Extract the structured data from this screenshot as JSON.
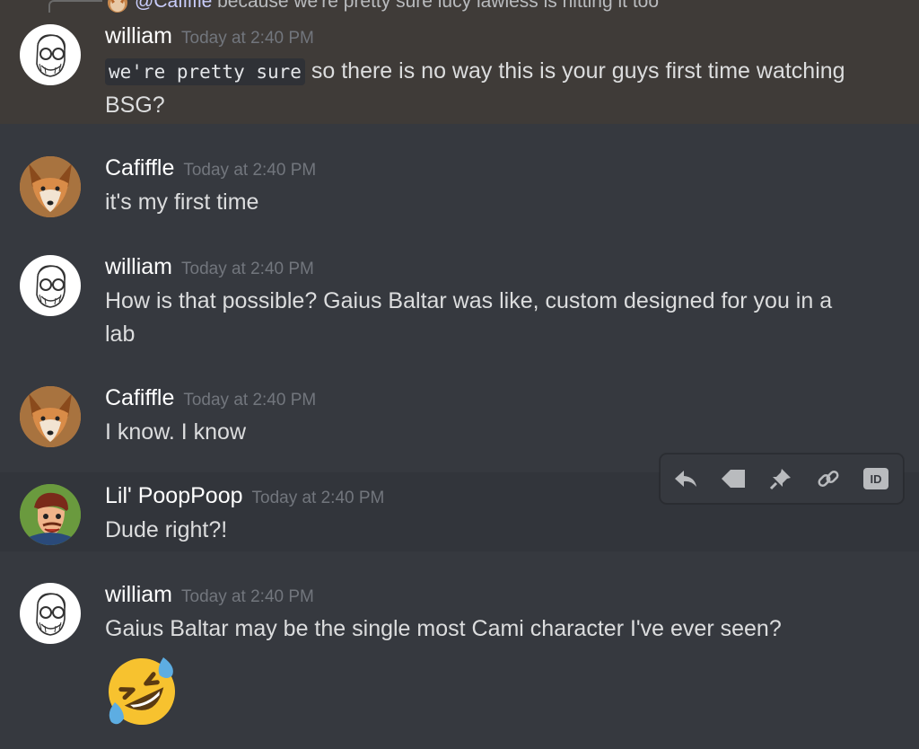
{
  "reply_preview": {
    "mention": "@Cafiffle",
    "text": " because we're pretty sure lucy lawless is hitting it too"
  },
  "messages": [
    {
      "username": "william",
      "timestamp": "Today at 2:40 PM",
      "code": "we're pretty sure",
      "text": " so there is no way this is your guys first time watching BSG?"
    },
    {
      "username": "Cafiffle",
      "timestamp": "Today at 2:40 PM",
      "text": "it's my first time"
    },
    {
      "username": "william",
      "timestamp": "Today at 2:40 PM",
      "text": "How is that possible? Gaius Baltar was like, custom designed for you in a lab"
    },
    {
      "username": "Cafiffle",
      "timestamp": "Today at 2:40 PM",
      "text": "I know.  I know"
    },
    {
      "username": "Lil' PoopPoop",
      "timestamp": "Today at 2:40 PM",
      "text": "Dude right?!"
    },
    {
      "username": "william",
      "timestamp": "Today at 2:40 PM",
      "text": "Gaius Baltar may be the single most Cami character I've ever seen?"
    }
  ],
  "toolbar": {
    "icons": [
      "reply-icon",
      "tag-icon",
      "pin-icon",
      "link-icon",
      "id-icon"
    ],
    "id_label": "ID"
  },
  "colors": {
    "background": "#36393f",
    "highlight": "#3f3b38",
    "username": "#ffffff",
    "timestamp": "#72767d",
    "text": "#dcddde"
  }
}
